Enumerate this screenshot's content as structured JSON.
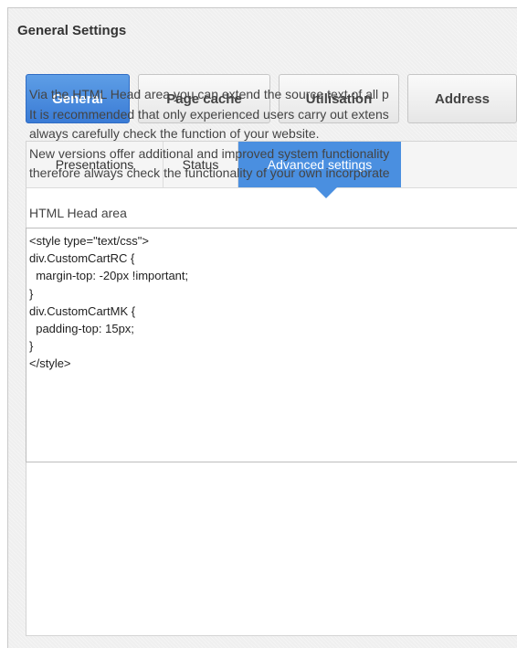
{
  "page": {
    "title": "General Settings"
  },
  "main_tabs": [
    {
      "label": "General",
      "active": true
    },
    {
      "label": "Page cache",
      "active": false
    },
    {
      "label": "Utilisation",
      "active": false
    },
    {
      "label": "Address",
      "active": false
    }
  ],
  "sub_tabs": [
    {
      "label": "Presentations",
      "active": false
    },
    {
      "label": "Status",
      "active": false
    },
    {
      "label": "Advanced settings",
      "active": true
    }
  ],
  "description": {
    "lines": [
      "Via the HTML Head area you can extend the source text of all p",
      "It is recommended that only experienced users carry out extens",
      "always carefully check the function of your website.",
      "New versions offer additional and improved system functionality",
      "therefore always check the functionality of your own incorporate"
    ]
  },
  "head_area": {
    "label": "HTML Head area",
    "code_lines": [
      "<style type=\"text/css\">",
      "div.CustomCartRC {",
      "  margin-top: -20px !important;",
      "}",
      "div.CustomCartMK {",
      "  padding-top: 15px;",
      "}",
      "</style>"
    ]
  },
  "colors": {
    "accent": "#3a7bd5",
    "subtab_active": "#4a8fe0"
  }
}
